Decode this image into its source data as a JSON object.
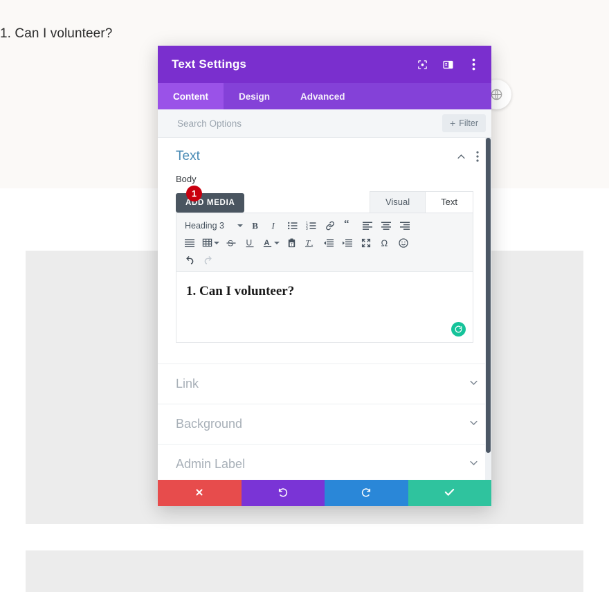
{
  "background": {
    "heading": "1. Can I volunteer?"
  },
  "globe_button": {
    "icon": "globe-icon"
  },
  "modal": {
    "title": "Text Settings",
    "header_icons": [
      {
        "name": "focus-mode-icon"
      },
      {
        "name": "split-view-icon"
      },
      {
        "name": "more-options-icon"
      }
    ],
    "tabs": [
      {
        "label": "Content",
        "active": true
      },
      {
        "label": "Design",
        "active": false
      },
      {
        "label": "Advanced",
        "active": false
      }
    ],
    "search": {
      "placeholder": "Search Options",
      "value": ""
    },
    "filter_button": {
      "label": "Filter",
      "plus": "+"
    },
    "section": {
      "title": "Text",
      "collapse_icon": "chevron-up-icon",
      "menu_icon": "more-options-icon"
    },
    "field": {
      "label": "Body",
      "add_media_label": "ADD MEDIA",
      "editor_tabs": [
        {
          "label": "Visual",
          "active": false
        },
        {
          "label": "Text",
          "active": true
        }
      ],
      "format_select": "Heading 3",
      "toolbar_row1": [
        {
          "name": "bold-icon"
        },
        {
          "name": "italic-icon"
        },
        {
          "name": "bulleted-list-icon"
        },
        {
          "name": "numbered-list-icon"
        },
        {
          "name": "link-icon"
        },
        {
          "name": "blockquote-icon"
        },
        {
          "name": "align-left-icon"
        },
        {
          "name": "align-center-icon"
        },
        {
          "name": "align-right-icon"
        }
      ],
      "toolbar_row2": [
        {
          "name": "align-justify-icon"
        },
        {
          "name": "table-icon"
        },
        {
          "name": "strikethrough-icon"
        },
        {
          "name": "underline-icon"
        },
        {
          "name": "text-color-icon"
        },
        {
          "name": "paste-as-text-icon"
        },
        {
          "name": "clear-formatting-icon"
        },
        {
          "name": "outdent-icon"
        },
        {
          "name": "indent-icon"
        },
        {
          "name": "fullscreen-icon"
        },
        {
          "name": "special-character-icon"
        },
        {
          "name": "emoticon-icon"
        }
      ],
      "toolbar_row3": [
        {
          "name": "undo-icon"
        },
        {
          "name": "redo-icon"
        }
      ],
      "editor_text": "1. Can I volunteer?",
      "spellcheck_badge": "grammarly-icon"
    },
    "step_marker": "1",
    "accordions": [
      {
        "label": "Link",
        "icon": "chevron-down-icon"
      },
      {
        "label": "Background",
        "icon": "chevron-down-icon"
      },
      {
        "label": "Admin Label",
        "icon": "chevron-down-icon"
      }
    ],
    "footer_buttons": [
      {
        "name": "cancel-button",
        "icon": "close-icon",
        "color": "#e74c4c"
      },
      {
        "name": "undo-button",
        "icon": "undo-arrow-icon",
        "color": "#7a34d6"
      },
      {
        "name": "redo-button",
        "icon": "redo-arrow-icon",
        "color": "#2a87d8"
      },
      {
        "name": "save-button",
        "icon": "checkmark-icon",
        "color": "#2fc39e"
      }
    ]
  }
}
